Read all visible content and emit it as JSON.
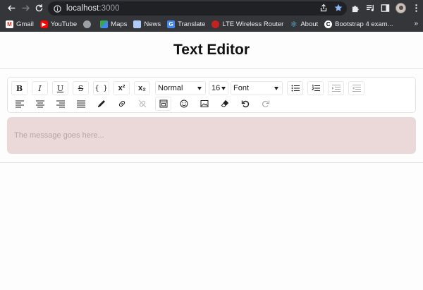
{
  "browser": {
    "url_host": "localhost",
    "url_port": ":3000",
    "bookmarks": [
      {
        "label": "Gmail",
        "icon": "gmail-icon"
      },
      {
        "label": "YouTube",
        "icon": "youtube-icon"
      },
      {
        "label": "",
        "icon": "globe-icon"
      },
      {
        "label": "Maps",
        "icon": "maps-icon"
      },
      {
        "label": "News",
        "icon": "news-icon"
      },
      {
        "label": "Translate",
        "icon": "translate-icon"
      },
      {
        "label": "LTE Wireless Router",
        "icon": "router-icon"
      },
      {
        "label": "About",
        "icon": "react-icon"
      },
      {
        "label": "Bootstrap 4 exam...",
        "icon": "bootstrap-icon"
      }
    ],
    "more": "»"
  },
  "page": {
    "title": "Text Editor"
  },
  "toolbar": {
    "bold": "B",
    "italic": "I",
    "underline": "U",
    "strike": "S",
    "code": "{ }",
    "superscript": "x²",
    "subscript": "x₂",
    "block_type": "Normal",
    "font_size": "16",
    "font_family": "Font"
  },
  "editor": {
    "placeholder": "The message goes here..."
  },
  "colors": {
    "chrome": "#35363a",
    "omnibox": "#202124",
    "editor_bg": "#ead9d8",
    "star": "#8ab4f8"
  }
}
